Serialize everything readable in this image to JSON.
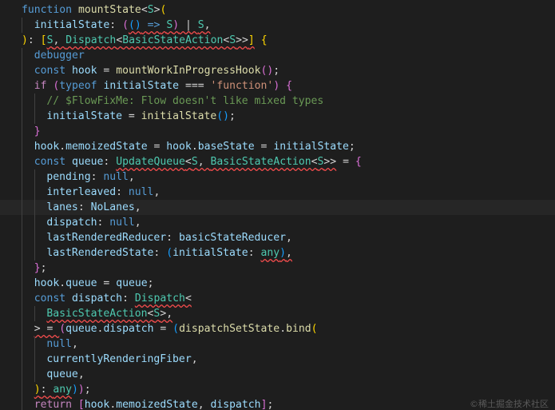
{
  "editor": {
    "language": "javascript",
    "theme_colors": {
      "background": "#1e1e1e",
      "keyword": "#569cd6",
      "control": "#c586c0",
      "function": "#dcdcaa",
      "variable": "#9cdcfe",
      "type": "#4ec9b0",
      "string": "#ce9178",
      "comment": "#6a9955",
      "bracket_1": "#ffd700",
      "bracket_2": "#da70d6",
      "bracket_3": "#179fff",
      "error_squiggle": "#f14c4c"
    },
    "lines": [
      {
        "indent": 0,
        "tokens": [
          [
            "kw",
            "function"
          ],
          [
            "plain",
            " "
          ],
          [
            "fn",
            "mountState"
          ],
          [
            "plain",
            "<"
          ],
          [
            "type",
            "S"
          ],
          [
            "plain",
            ">"
          ],
          [
            "b1",
            "("
          ]
        ]
      },
      {
        "indent": 1,
        "tokens": [
          [
            "var",
            "initialState"
          ],
          [
            "plain",
            ": "
          ],
          [
            "b2",
            "("
          ],
          [
            "b3",
            "()"
          ],
          [
            "plain",
            " "
          ],
          [
            "kw",
            "=>"
          ],
          [
            "plain",
            " "
          ],
          [
            "type",
            "S"
          ],
          [
            "b2",
            ")"
          ],
          [
            "plain",
            " | "
          ],
          [
            "type",
            "S"
          ],
          [
            "plain",
            ","
          ]
        ],
        "squiggle_from": 3
      },
      {
        "indent": 0,
        "tokens": [
          [
            "b1",
            ")"
          ],
          [
            "plain",
            ": "
          ],
          [
            "b1",
            "["
          ],
          [
            "type",
            "S"
          ],
          [
            "plain",
            ", "
          ],
          [
            "type",
            "Dispatch"
          ],
          [
            "plain",
            "<"
          ],
          [
            "type",
            "BasicStateAction"
          ],
          [
            "plain",
            "<"
          ],
          [
            "type",
            "S"
          ],
          [
            "plain",
            ">>"
          ],
          [
            "b1",
            "]"
          ],
          [
            "plain",
            " "
          ],
          [
            "b1",
            "{"
          ]
        ],
        "squiggle_from": 3,
        "squiggle_to": 11
      },
      {
        "indent": 1,
        "tokens": [
          [
            "kw",
            "debugger"
          ]
        ]
      },
      {
        "indent": 1,
        "tokens": [
          [
            "kw",
            "const"
          ],
          [
            "plain",
            " "
          ],
          [
            "var",
            "hook"
          ],
          [
            "plain",
            " = "
          ],
          [
            "fn",
            "mountWorkInProgressHook"
          ],
          [
            "b2",
            "()"
          ],
          [
            "plain",
            ";"
          ]
        ]
      },
      {
        "indent": 1,
        "tokens": [
          [
            "ctl",
            "if"
          ],
          [
            "plain",
            " "
          ],
          [
            "b2",
            "("
          ],
          [
            "kw",
            "typeof"
          ],
          [
            "plain",
            " "
          ],
          [
            "var",
            "initialState"
          ],
          [
            "plain",
            " === "
          ],
          [
            "str",
            "'function'"
          ],
          [
            "b2",
            ")"
          ],
          [
            "plain",
            " "
          ],
          [
            "b2",
            "{"
          ]
        ]
      },
      {
        "indent": 2,
        "tokens": [
          [
            "cmt",
            "// $FlowFixMe: Flow doesn't like mixed types"
          ]
        ]
      },
      {
        "indent": 2,
        "tokens": [
          [
            "var",
            "initialState"
          ],
          [
            "plain",
            " = "
          ],
          [
            "fn",
            "initialState"
          ],
          [
            "b3",
            "()"
          ],
          [
            "plain",
            ";"
          ]
        ]
      },
      {
        "indent": 1,
        "tokens": [
          [
            "b2",
            "}"
          ]
        ]
      },
      {
        "indent": 1,
        "tokens": [
          [
            "var",
            "hook"
          ],
          [
            "plain",
            "."
          ],
          [
            "var",
            "memoizedState"
          ],
          [
            "plain",
            " = "
          ],
          [
            "var",
            "hook"
          ],
          [
            "plain",
            "."
          ],
          [
            "var",
            "baseState"
          ],
          [
            "plain",
            " = "
          ],
          [
            "var",
            "initialState"
          ],
          [
            "plain",
            ";"
          ]
        ]
      },
      {
        "indent": 1,
        "tokens": [
          [
            "kw",
            "const"
          ],
          [
            "plain",
            " "
          ],
          [
            "var",
            "queue"
          ],
          [
            "plain",
            ": "
          ],
          [
            "type",
            "UpdateQueue"
          ],
          [
            "plain",
            "<"
          ],
          [
            "type",
            "S"
          ],
          [
            "plain",
            ", "
          ],
          [
            "type",
            "BasicStateAction"
          ],
          [
            "plain",
            "<"
          ],
          [
            "type",
            "S"
          ],
          [
            "plain",
            ">>"
          ],
          [
            "plain",
            " = "
          ],
          [
            "b2",
            "{"
          ]
        ],
        "squiggle_from": 4,
        "squiggle_to": 11
      },
      {
        "indent": 2,
        "tokens": [
          [
            "var",
            "pending"
          ],
          [
            "plain",
            ": "
          ],
          [
            "kw",
            "null"
          ],
          [
            "plain",
            ","
          ]
        ]
      },
      {
        "indent": 2,
        "tokens": [
          [
            "var",
            "interleaved"
          ],
          [
            "plain",
            ": "
          ],
          [
            "kw",
            "null"
          ],
          [
            "plain",
            ","
          ]
        ]
      },
      {
        "indent": 2,
        "tokens": [
          [
            "var",
            "lanes"
          ],
          [
            "plain",
            ": "
          ],
          [
            "var",
            "NoLanes"
          ],
          [
            "plain",
            ","
          ]
        ],
        "active": true
      },
      {
        "indent": 2,
        "tokens": [
          [
            "var",
            "dispatch"
          ],
          [
            "plain",
            ": "
          ],
          [
            "kw",
            "null"
          ],
          [
            "plain",
            ","
          ]
        ]
      },
      {
        "indent": 2,
        "tokens": [
          [
            "var",
            "lastRenderedReducer"
          ],
          [
            "plain",
            ": "
          ],
          [
            "var",
            "basicStateReducer"
          ],
          [
            "plain",
            ","
          ]
        ]
      },
      {
        "indent": 2,
        "tokens": [
          [
            "var",
            "lastRenderedState"
          ],
          [
            "plain",
            ": "
          ],
          [
            "b3",
            "("
          ],
          [
            "var",
            "initialState"
          ],
          [
            "plain",
            ": "
          ],
          [
            "type",
            "any"
          ],
          [
            "b3",
            ")"
          ],
          [
            "plain",
            ","
          ]
        ],
        "squiggle_from": 5,
        "squiggle_to": 7
      },
      {
        "indent": 1,
        "tokens": [
          [
            "b2",
            "}"
          ],
          [
            "plain",
            ";"
          ]
        ]
      },
      {
        "indent": 1,
        "tokens": [
          [
            "var",
            "hook"
          ],
          [
            "plain",
            "."
          ],
          [
            "var",
            "queue"
          ],
          [
            "plain",
            " = "
          ],
          [
            "var",
            "queue"
          ],
          [
            "plain",
            ";"
          ]
        ]
      },
      {
        "indent": 1,
        "tokens": [
          [
            "kw",
            "const"
          ],
          [
            "plain",
            " "
          ],
          [
            "var",
            "dispatch"
          ],
          [
            "plain",
            ": "
          ],
          [
            "type",
            "Dispatch"
          ],
          [
            "plain",
            "<"
          ]
        ],
        "squiggle_from": 4
      },
      {
        "indent": 2,
        "tokens": [
          [
            "type",
            "BasicStateAction"
          ],
          [
            "plain",
            "<"
          ],
          [
            "type",
            "S"
          ],
          [
            "plain",
            ">,"
          ]
        ],
        "squiggle_from": 0
      },
      {
        "indent": 1,
        "tokens": [
          [
            "plain",
            "> = "
          ],
          [
            "b2",
            "("
          ],
          [
            "var",
            "queue"
          ],
          [
            "plain",
            "."
          ],
          [
            "var",
            "dispatch"
          ],
          [
            "plain",
            " = "
          ],
          [
            "b3",
            "("
          ],
          [
            "fn",
            "dispatchSetState"
          ],
          [
            "plain",
            "."
          ],
          [
            "fn",
            "bind"
          ],
          [
            "b1",
            "("
          ]
        ],
        "squiggle_from": 0,
        "squiggle_to": 0,
        "pre_squiggle": true
      },
      {
        "indent": 2,
        "tokens": [
          [
            "kw",
            "null"
          ],
          [
            "plain",
            ","
          ]
        ]
      },
      {
        "indent": 2,
        "tokens": [
          [
            "var",
            "currentlyRenderingFiber"
          ],
          [
            "plain",
            ","
          ]
        ]
      },
      {
        "indent": 2,
        "tokens": [
          [
            "var",
            "queue"
          ],
          [
            "plain",
            ","
          ]
        ]
      },
      {
        "indent": 1,
        "tokens": [
          [
            "b1",
            ")"
          ],
          [
            "plain",
            ": "
          ],
          [
            "type",
            "any"
          ],
          [
            "b3",
            ")"
          ],
          [
            "b2",
            ")"
          ],
          [
            "plain",
            ";"
          ]
        ],
        "squiggle_from": 0,
        "squiggle_to": 2
      },
      {
        "indent": 1,
        "tokens": [
          [
            "ctl",
            "return"
          ],
          [
            "plain",
            " "
          ],
          [
            "b2",
            "["
          ],
          [
            "var",
            "hook"
          ],
          [
            "plain",
            "."
          ],
          [
            "var",
            "memoizedState"
          ],
          [
            "plain",
            ", "
          ],
          [
            "var",
            "dispatch"
          ],
          [
            "b2",
            "]"
          ],
          [
            "plain",
            ";"
          ]
        ],
        "squiggle_from": 2,
        "squiggle_to": 8
      }
    ]
  },
  "watermark": "©稀土掘金技术社区"
}
